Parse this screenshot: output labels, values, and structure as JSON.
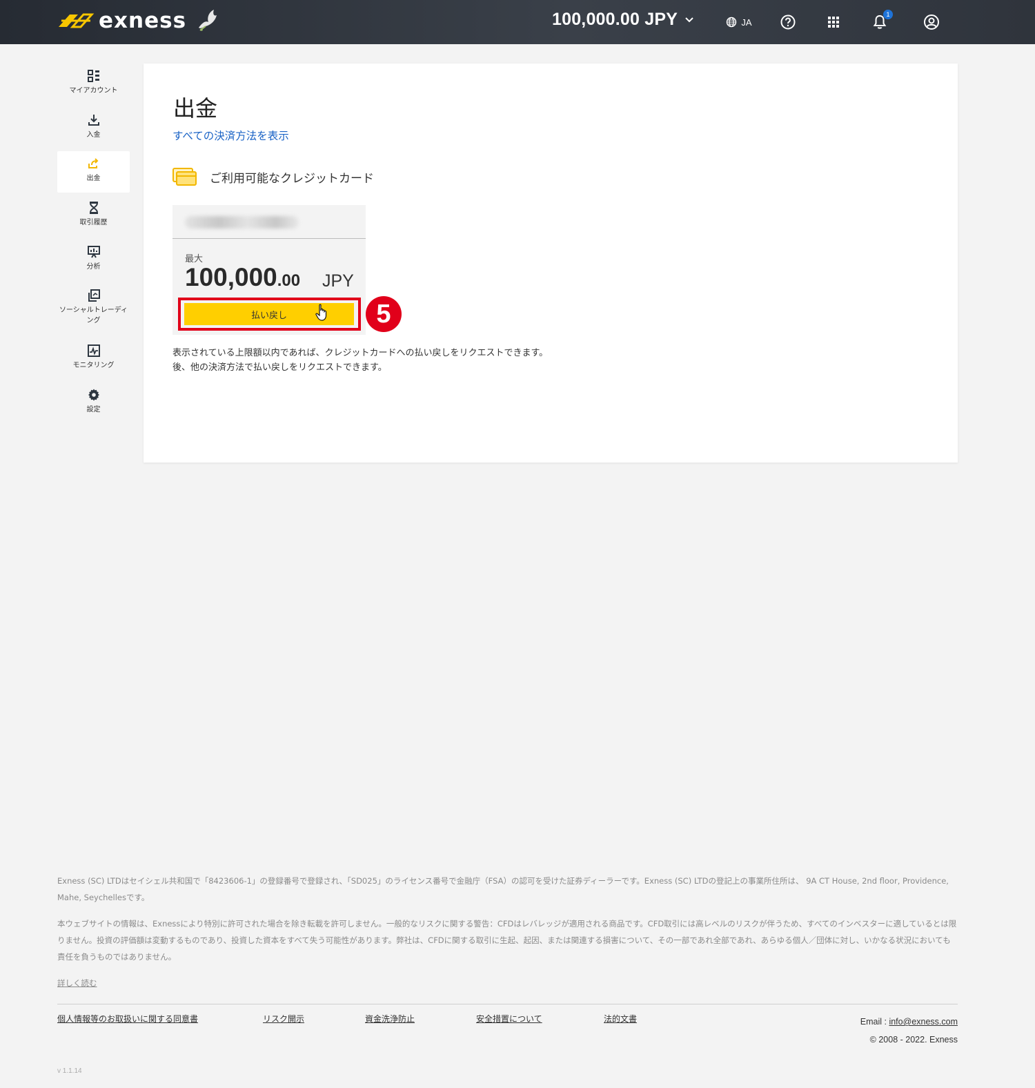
{
  "header": {
    "brand": "exness",
    "balance": "100,000.00 JPY",
    "language": "JA",
    "notification_count": "1"
  },
  "sidebar": {
    "items": [
      {
        "label": "マイアカウント",
        "icon": "dashboard-icon"
      },
      {
        "label": "入金",
        "icon": "download-icon"
      },
      {
        "label": "出金",
        "icon": "withdraw-icon",
        "active": true
      },
      {
        "label": "取引履歴",
        "icon": "hourglass-icon"
      },
      {
        "label": "分析",
        "icon": "presentation-chart-icon"
      },
      {
        "label": "ソーシャルトレーディング",
        "icon": "copy-icon"
      },
      {
        "label": "モニタリング",
        "icon": "monitor-chart-icon"
      },
      {
        "label": "設定",
        "icon": "gear-icon"
      }
    ]
  },
  "main": {
    "title": "出金",
    "all_methods_link": "すべての決済方法を表示",
    "available_cards_heading": "ご利用可能なクレジットカード",
    "card": {
      "max_label": "最大",
      "amount_int": "100,000",
      "amount_dec": ".00",
      "currency": "JPY",
      "refund_button": "払い戻し"
    },
    "step_number": "5",
    "info_line1": "表示されている上限額以内であれば、クレジットカードへの払い戻しをリクエストできます。",
    "info_line2": "後、他の決済方法で払い戻しをリクエストできます。"
  },
  "footer": {
    "para1": "Exness (SC) LTDはセイシェル共和国で「8423606-1」の登録番号で登録され、「SD025」のライセンス番号で金融庁（FSA）の認可を受けた証券ディーラーです。Exness (SC) LTDの登記上の事業所住所は、 9A CT House, 2nd floor, Providence, Mahe, Seychellesです。",
    "para2": "本ウェブサイトの情報は、Exnessにより特別に許可された場合を除き転載を許可しません。一般的なリスクに関する警告：CFDはレバレッジが適用される商品です。CFD取引には高レベルのリスクが伴うため、すべてのインベスターに適しているとは限りません。投資の評価額は変動するものであり、投資した資本をすべて失う可能性があります。弊社は、CFDに関する取引に生起、起因、または関連する損害について、その一部であれ全部であれ、あらゆる個人／団体に対し、いかなる状況においても責任を負うものではありません。",
    "read_more": "詳しく読む",
    "links": [
      "個人情報等のお取扱いに関する同意書",
      "リスク開示",
      "資金洗浄防止",
      "安全措置について",
      "法的文書"
    ],
    "email_label": "Email : ",
    "email": "info@exness.com",
    "copyright": "© 2008 - 2022. Exness",
    "version": "v 1.1.14"
  },
  "colors": {
    "accent": "#ffcf00",
    "link": "#1a63c6",
    "highlight": "#e1001a",
    "header_bg": "#2f343c"
  }
}
